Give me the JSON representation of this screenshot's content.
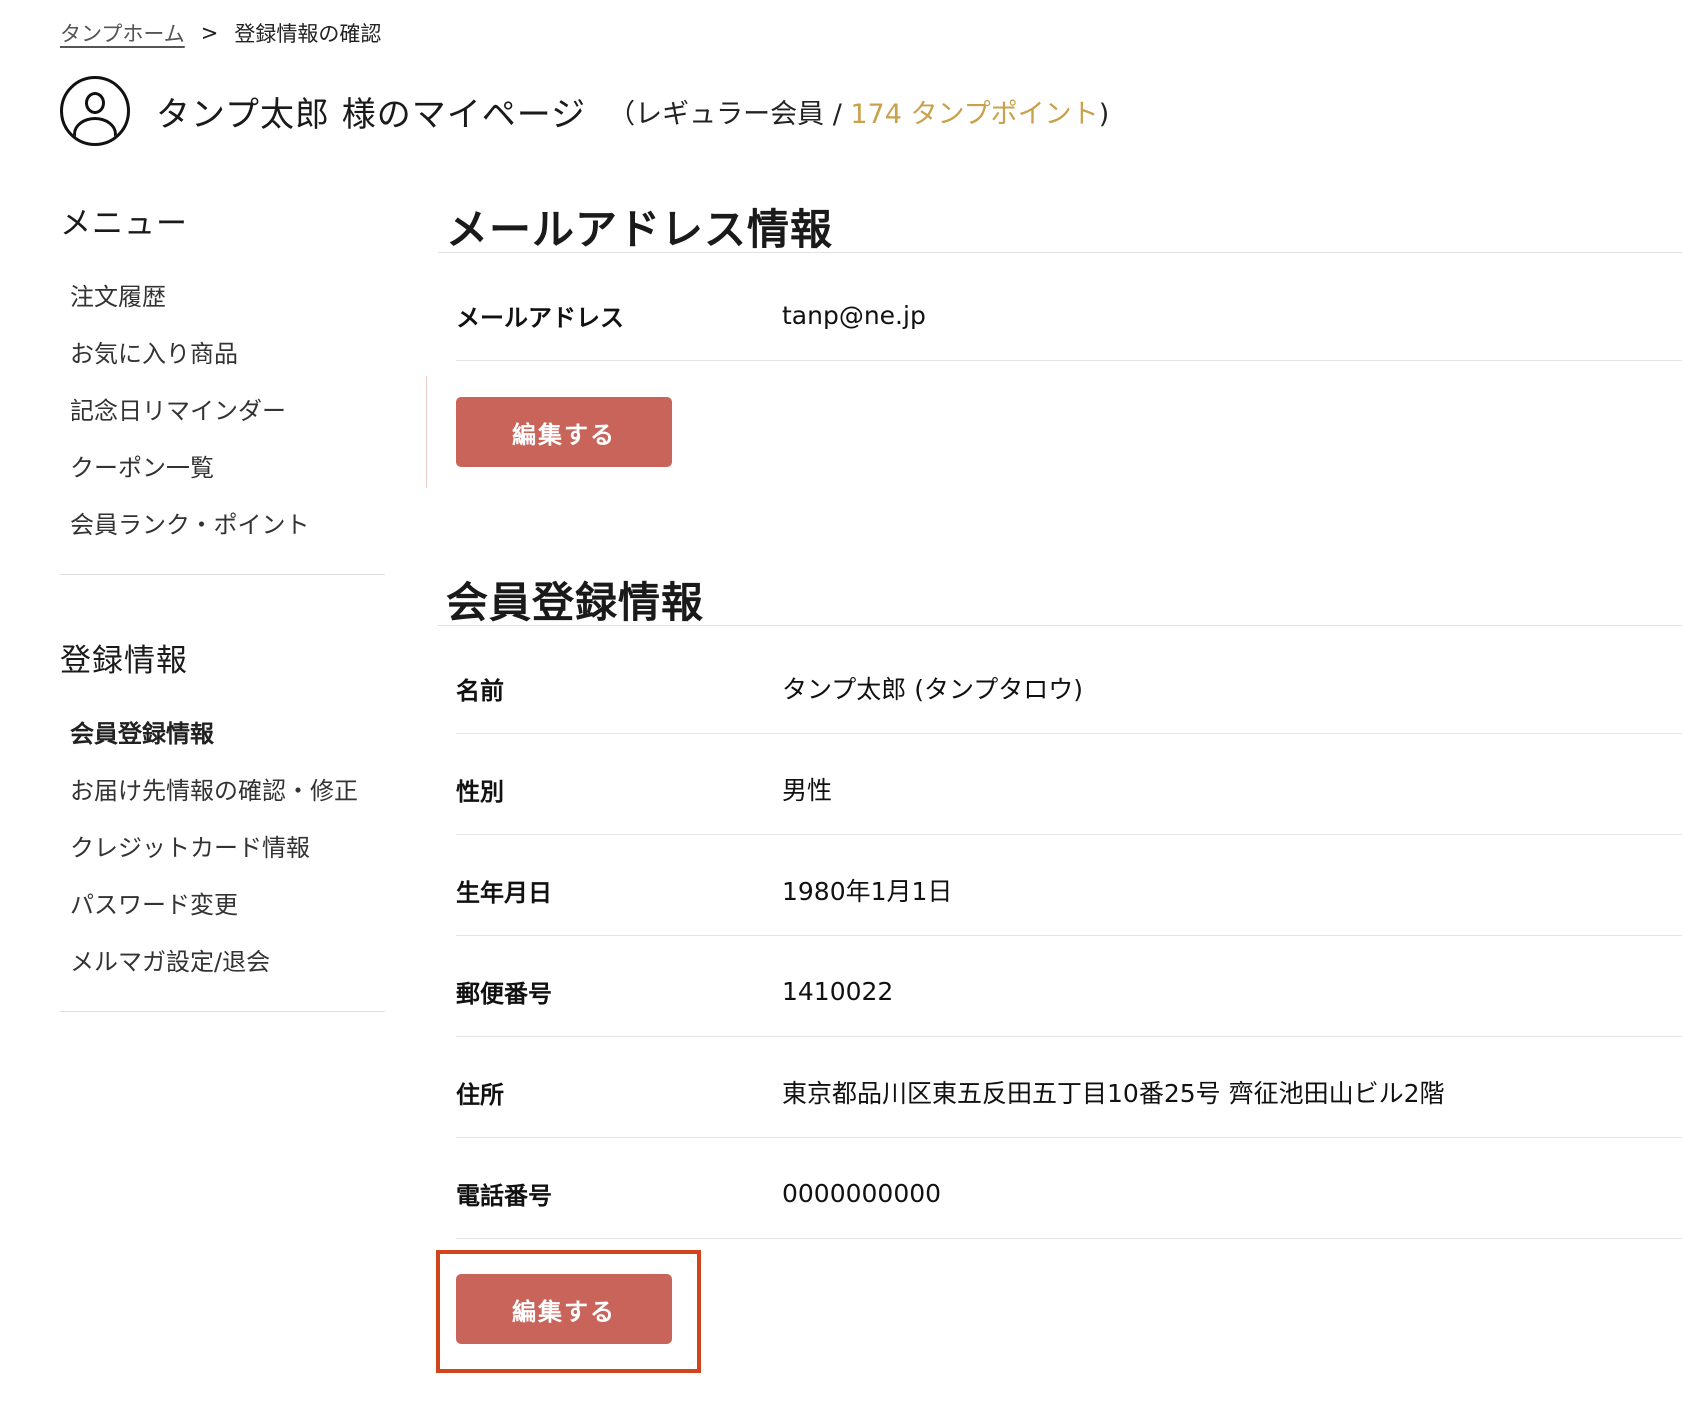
{
  "breadcrumb": {
    "home": "タンプホーム",
    "separator": ">",
    "current": "登録情報の確認"
  },
  "header": {
    "title": "タンプ太郎 様のマイページ",
    "member_prefix": "（レギュラー会員 / ",
    "points": "174 タンプポイント",
    "member_suffix": ")"
  },
  "sidebar": {
    "menu_title": "メニュー",
    "menu_items": [
      {
        "label": "注文履歴"
      },
      {
        "label": "お気に入り商品"
      },
      {
        "label": "記念日リマインダー"
      },
      {
        "label": "クーポン一覧"
      },
      {
        "label": "会員ランク・ポイント"
      }
    ],
    "register_title": "登録情報",
    "register_items": [
      {
        "label": "会員登録情報"
      },
      {
        "label": "お届け先情報の確認・修正"
      },
      {
        "label": "クレジットカード情報"
      },
      {
        "label": "パスワード変更"
      },
      {
        "label": "メルマガ設定/退会"
      }
    ]
  },
  "email_section": {
    "title": "メールアドレス情報",
    "rows": [
      {
        "label": "メールアドレス",
        "value": "tanp@ne.jp"
      }
    ],
    "edit_label": "編集する"
  },
  "member_section": {
    "title": "会員登録情報",
    "rows": [
      {
        "label": "名前",
        "value": "タンプ太郎 (タンプタロウ)"
      },
      {
        "label": "性別",
        "value": "男性"
      },
      {
        "label": "生年月日",
        "value": "1980年1月1日"
      },
      {
        "label": "郵便番号",
        "value": "1410022"
      },
      {
        "label": "住所",
        "value": "東京都品川区東五反田五丁目10番25号 齊征池田山ビル2階"
      },
      {
        "label": "電話番号",
        "value": "0000000000"
      }
    ],
    "edit_label": "編集する"
  },
  "colors": {
    "button": "#c8645a",
    "points": "#c9a14a",
    "highlight": "#d0451b"
  },
  "icons": {
    "avatar": "user-circle-icon"
  }
}
